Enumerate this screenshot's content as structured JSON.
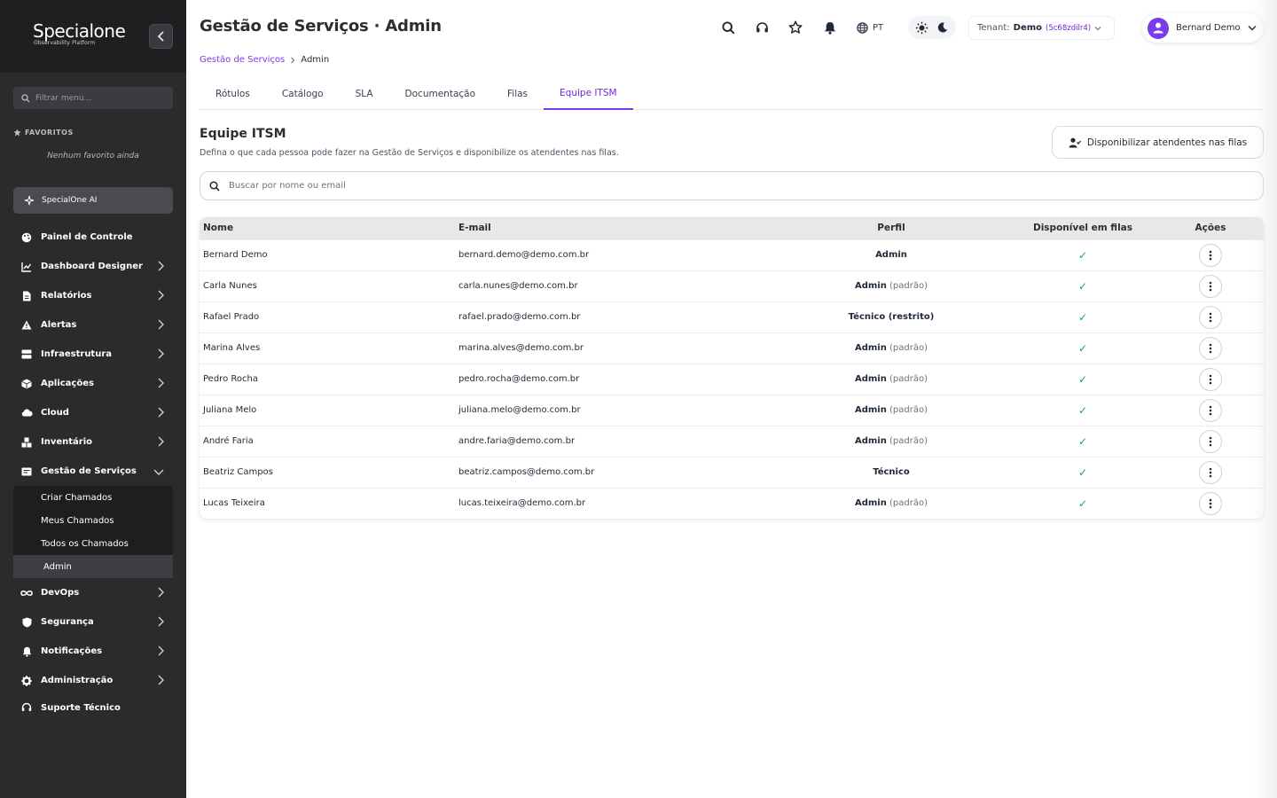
{
  "brand": {
    "name": "Specialone",
    "tagline": "Observability Platform"
  },
  "sidebar": {
    "filter_placeholder": "Filtrar menu...",
    "favorites_title": "FAVORITOS",
    "favorites_empty": "Nenhum favorito ainda",
    "ai_label": "SpecialOne AI",
    "items": [
      {
        "label": "Painel de Controle",
        "icon": "palette-icon",
        "chevron": false
      },
      {
        "label": "Dashboard Designer",
        "icon": "chart-line-icon",
        "chevron": true
      },
      {
        "label": "Relatórios",
        "icon": "document-icon",
        "chevron": true
      },
      {
        "label": "Alertas",
        "icon": "warning-icon",
        "chevron": true
      },
      {
        "label": "Infraestrutura",
        "icon": "server-icon",
        "chevron": true
      },
      {
        "label": "Aplicações",
        "icon": "box-icon",
        "chevron": true
      },
      {
        "label": "Cloud",
        "icon": "cloud-icon",
        "chevron": true
      },
      {
        "label": "Inventário",
        "icon": "boxes-icon",
        "chevron": true
      },
      {
        "label": "Gestão de Serviços",
        "icon": "ticket-icon",
        "chevron": true,
        "expanded": true
      }
    ],
    "sub_items": [
      {
        "label": "Criar Chamados",
        "active": false
      },
      {
        "label": "Meus Chamados",
        "active": false
      },
      {
        "label": "Todos os Chamados",
        "active": false
      },
      {
        "label": "Admin",
        "active": true
      }
    ],
    "items_after": [
      {
        "label": "DevOps",
        "icon": "infinity-icon",
        "chevron": true
      },
      {
        "label": "Segurança",
        "icon": "shield-icon",
        "chevron": true
      },
      {
        "label": "Notificações",
        "icon": "bell-icon",
        "chevron": true
      },
      {
        "label": "Administração",
        "icon": "gear-icon",
        "chevron": true
      },
      {
        "label": "Suporte Técnico",
        "icon": "headset-icon",
        "chevron": false
      }
    ]
  },
  "header": {
    "title": "Gestão de Serviços · Admin",
    "language": "PT",
    "tenant_label": "Tenant:",
    "tenant_name": "Demo",
    "tenant_id": "(5c68zdilr4)",
    "user_name": "Bernard Demo"
  },
  "breadcrumb": {
    "parent": "Gestão de Serviços",
    "current": "Admin"
  },
  "tabs": [
    {
      "label": "Rótulos",
      "active": false
    },
    {
      "label": "Catálogo",
      "active": false
    },
    {
      "label": "SLA",
      "active": false
    },
    {
      "label": "Documentação",
      "active": false
    },
    {
      "label": "Filas",
      "active": false
    },
    {
      "label": "Equipe ITSM",
      "active": true
    }
  ],
  "section": {
    "title": "Equipe ITSM",
    "description": "Defina o que cada pessoa pode fazer na Gestão de Serviços e disponibilize os atendentes nas filas.",
    "action_label": "Disponibilizar atendentes nas filas",
    "search_placeholder": "Buscar por nome ou email"
  },
  "table": {
    "columns": [
      "Nome",
      "E-mail",
      "Perfil",
      "Disponível em filas",
      "Ações"
    ],
    "rows": [
      {
        "name": "Bernard Demo",
        "email": "bernard.demo@demo.com.br",
        "role": "Admin",
        "role_note": "",
        "available": "✓"
      },
      {
        "name": "Carla Nunes",
        "email": "carla.nunes@demo.com.br",
        "role": "Admin",
        "role_note": "(padrão)",
        "available": "✓"
      },
      {
        "name": "Rafael Prado",
        "email": "rafael.prado@demo.com.br",
        "role": "Técnico (restrito)",
        "role_note": "",
        "available": "✓"
      },
      {
        "name": "Marina Alves",
        "email": "marina.alves@demo.com.br",
        "role": "Admin",
        "role_note": "(padrão)",
        "available": "✓"
      },
      {
        "name": "Pedro Rocha",
        "email": "pedro.rocha@demo.com.br",
        "role": "Admin",
        "role_note": "(padrão)",
        "available": "✓"
      },
      {
        "name": "Juliana Melo",
        "email": "juliana.melo@demo.com.br",
        "role": "Admin",
        "role_note": "(padrão)",
        "available": "✓"
      },
      {
        "name": "André Faria",
        "email": "andre.faria@demo.com.br",
        "role": "Admin",
        "role_note": "(padrão)",
        "available": "✓"
      },
      {
        "name": "Beatriz Campos",
        "email": "beatriz.campos@demo.com.br",
        "role": "Técnico",
        "role_note": "",
        "available": "✓"
      },
      {
        "name": "Lucas Teixeira",
        "email": "lucas.teixeira@demo.com.br",
        "role": "Admin",
        "role_note": "(padrão)",
        "available": "✓"
      }
    ]
  },
  "colors": {
    "accent": "#7c3aed",
    "sidebar_bg": "#2b2b2e",
    "check": "#10a37f"
  }
}
